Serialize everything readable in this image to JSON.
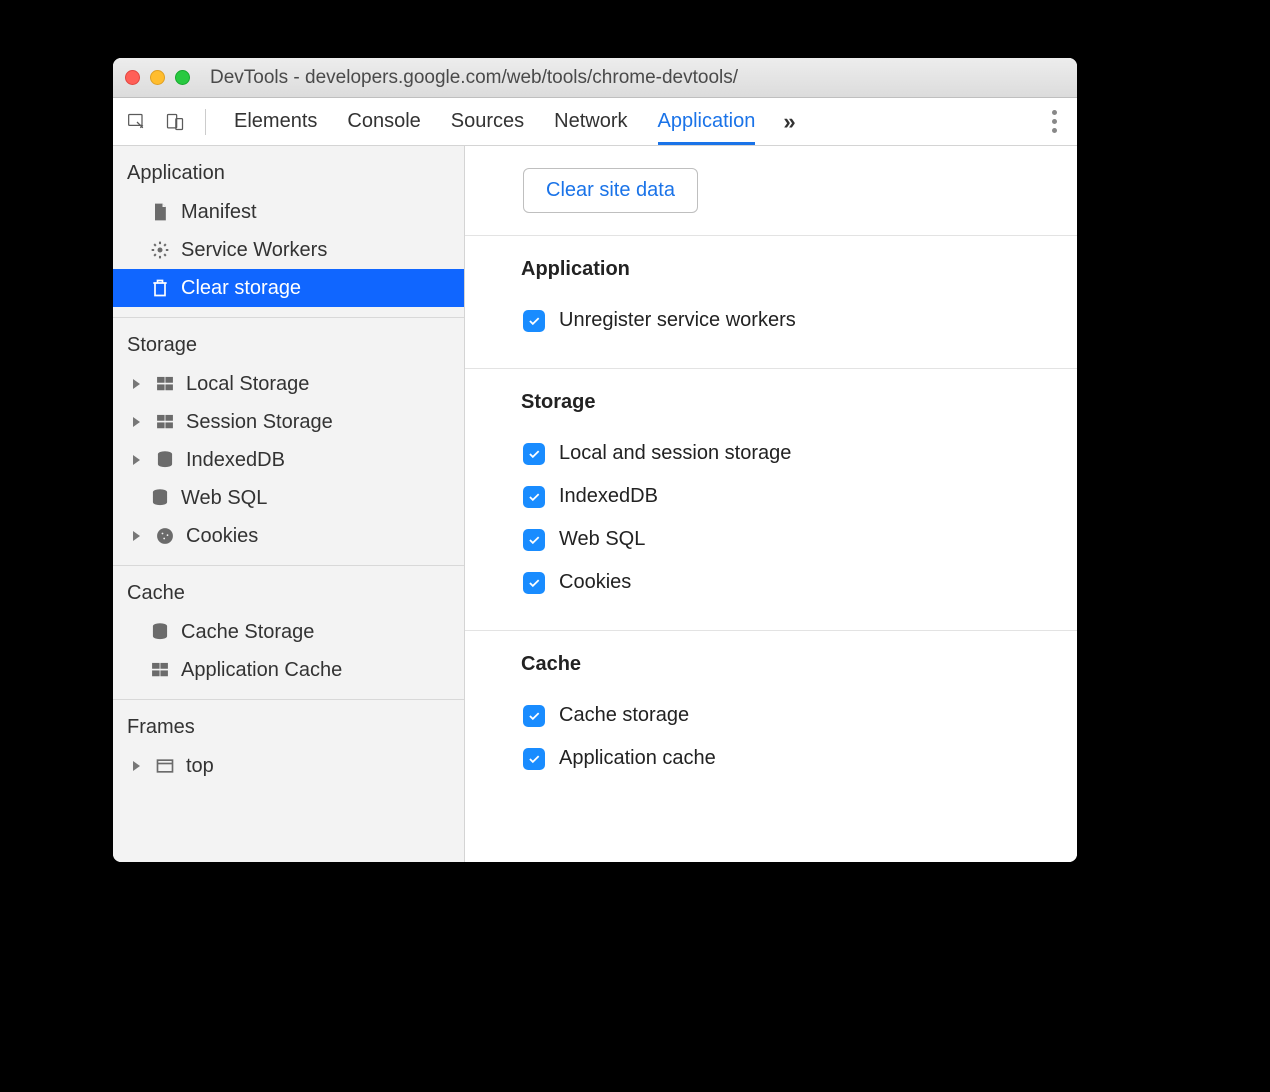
{
  "window": {
    "title": "DevTools - developers.google.com/web/tools/chrome-devtools/"
  },
  "toolbar": {
    "tabs": [
      "Elements",
      "Console",
      "Sources",
      "Network",
      "Application"
    ],
    "active_tab": "Application"
  },
  "sidebar": {
    "groups": [
      {
        "heading": "Application",
        "items": [
          {
            "label": "Manifest",
            "icon": "document",
            "expandable": false
          },
          {
            "label": "Service Workers",
            "icon": "gear",
            "expandable": false
          },
          {
            "label": "Clear storage",
            "icon": "trash",
            "expandable": false,
            "selected": true
          }
        ]
      },
      {
        "heading": "Storage",
        "items": [
          {
            "label": "Local Storage",
            "icon": "grid",
            "expandable": true
          },
          {
            "label": "Session Storage",
            "icon": "grid",
            "expandable": true
          },
          {
            "label": "IndexedDB",
            "icon": "database",
            "expandable": true
          },
          {
            "label": "Web SQL",
            "icon": "database",
            "expandable": false
          },
          {
            "label": "Cookies",
            "icon": "cookie",
            "expandable": true
          }
        ]
      },
      {
        "heading": "Cache",
        "items": [
          {
            "label": "Cache Storage",
            "icon": "database",
            "expandable": false
          },
          {
            "label": "Application Cache",
            "icon": "grid",
            "expandable": false
          }
        ]
      },
      {
        "heading": "Frames",
        "items": [
          {
            "label": "top",
            "icon": "frame",
            "expandable": true
          }
        ]
      }
    ]
  },
  "main": {
    "clear_button": "Clear site data",
    "sections": [
      {
        "heading": "Application",
        "checks": [
          {
            "label": "Unregister service workers",
            "checked": true
          }
        ]
      },
      {
        "heading": "Storage",
        "checks": [
          {
            "label": "Local and session storage",
            "checked": true
          },
          {
            "label": "IndexedDB",
            "checked": true
          },
          {
            "label": "Web SQL",
            "checked": true
          },
          {
            "label": "Cookies",
            "checked": true
          }
        ]
      },
      {
        "heading": "Cache",
        "checks": [
          {
            "label": "Cache storage",
            "checked": true
          },
          {
            "label": "Application cache",
            "checked": true
          }
        ]
      }
    ]
  },
  "icons": {
    "document": "document-icon",
    "gear": "gear-icon",
    "trash": "trash-icon",
    "grid": "grid-icon",
    "database": "database-icon",
    "cookie": "cookie-icon",
    "frame": "frame-icon"
  }
}
